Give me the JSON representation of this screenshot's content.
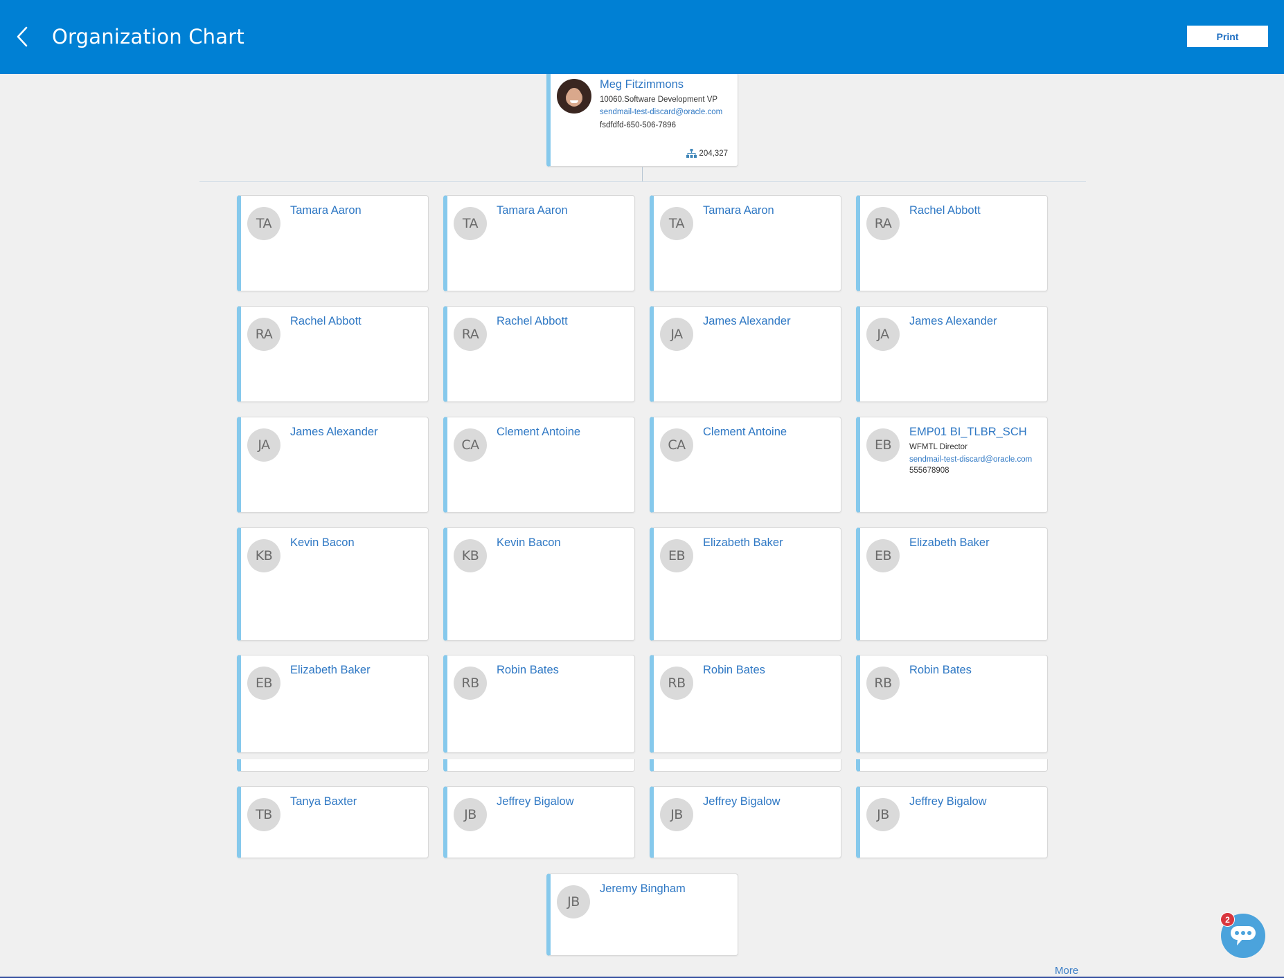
{
  "header": {
    "title": "Organization Chart",
    "back_icon": "chevron-left-icon",
    "print_label": "Print"
  },
  "manager": {
    "name": "Meg Fitzimmons",
    "title": "10060.Software Development VP",
    "email": "sendmail-test-discard@oracle.com",
    "phone": "fsdfdfd-650-506-7896",
    "reports_icon": "hierarchy-icon",
    "reports_count": "204,327"
  },
  "reports": [
    {
      "initials": "TA",
      "name": "Tamara Aaron"
    },
    {
      "initials": "TA",
      "name": "Tamara Aaron"
    },
    {
      "initials": "TA",
      "name": "Tamara Aaron"
    },
    {
      "initials": "RA",
      "name": "Rachel Abbott"
    },
    {
      "initials": "RA",
      "name": "Rachel Abbott"
    },
    {
      "initials": "RA",
      "name": "Rachel Abbott"
    },
    {
      "initials": "JA",
      "name": "James Alexander"
    },
    {
      "initials": "JA",
      "name": "James Alexander"
    },
    {
      "initials": "JA",
      "name": "James Alexander"
    },
    {
      "initials": "CA",
      "name": "Clement Antoine"
    },
    {
      "initials": "CA",
      "name": "Clement Antoine"
    },
    {
      "initials": "EB",
      "name": "EMP01 BI_TLBR_SCH",
      "title": "WFMTL Director",
      "email": "sendmail-test-discard@oracle.com",
      "phone": "555678908"
    },
    {
      "initials": "KB",
      "name": "Kevin Bacon"
    },
    {
      "initials": "KB",
      "name": "Kevin Bacon"
    },
    {
      "initials": "EB",
      "name": "Elizabeth Baker"
    },
    {
      "initials": "EB",
      "name": "Elizabeth Baker"
    },
    {
      "initials": "EB",
      "name": "Elizabeth Baker"
    },
    {
      "initials": "RB",
      "name": "Robin Bates"
    },
    {
      "initials": "RB",
      "name": "Robin Bates"
    },
    {
      "initials": "RB",
      "name": "Robin Bates"
    },
    {
      "initials": "TB",
      "name": "Tanya Baxter"
    },
    {
      "initials": "JB",
      "name": "Jeffrey Bigalow"
    },
    {
      "initials": "JB",
      "name": "Jeffrey Bigalow"
    },
    {
      "initials": "JB",
      "name": "Jeffrey Bigalow"
    },
    {
      "initials": "JB",
      "name": "Jeremy Bingham"
    }
  ],
  "footer": {
    "more_label": "More"
  },
  "chat": {
    "icon": "chat-bubble-icon",
    "badge_count": "2"
  },
  "colors": {
    "header_bg": "#0080d4",
    "accent_border": "#86c9ec",
    "link": "#2f78c4",
    "badge": "#d9363e",
    "chat_button": "#4ba3dc"
  }
}
